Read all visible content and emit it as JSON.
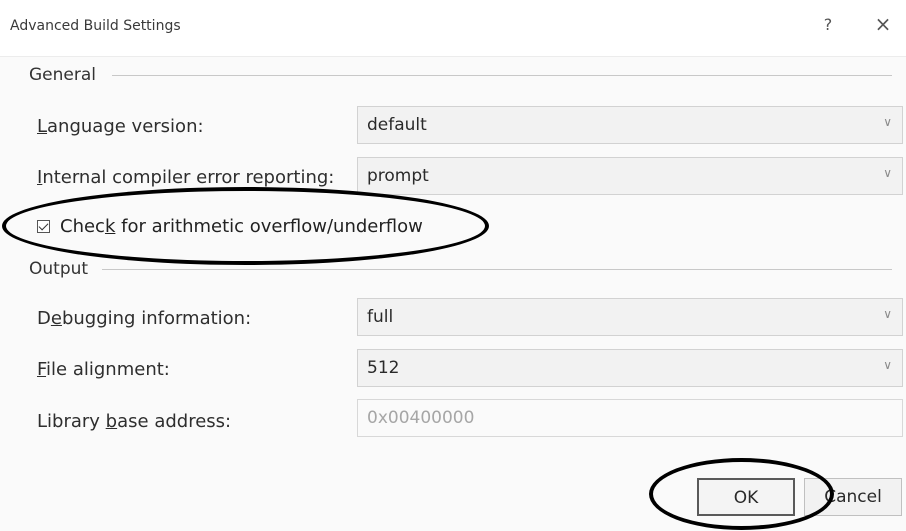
{
  "window": {
    "title": "Advanced Build Settings",
    "help_glyph": "?",
    "close_glyph": "×"
  },
  "general": {
    "group_label": "General",
    "language_version": {
      "label_pre": "",
      "label_accel": "L",
      "label_post": "anguage version:",
      "value": "default"
    },
    "ice_reporting": {
      "label_pre": "",
      "label_accel": "I",
      "label_post": "nternal compiler error reporting:",
      "value": "prompt"
    },
    "overflow_check": {
      "label_pre": "Chec",
      "label_accel": "k",
      "label_post": " for arithmetic overflow/underflow",
      "checked": true
    }
  },
  "output": {
    "group_label": "Output",
    "debugging": {
      "label_pre": "D",
      "label_accel": "e",
      "label_post": "bugging information:",
      "value": "full"
    },
    "file_alignment": {
      "label_pre": "",
      "label_accel": "F",
      "label_post": "ile alignment:",
      "value": "512"
    },
    "library_base": {
      "label_pre": "Library ",
      "label_accel": "b",
      "label_post": "ase address:",
      "value": "0x00400000"
    }
  },
  "buttons": {
    "ok": "OK",
    "cancel": "Cancel"
  },
  "icons": {
    "dropdown": "chevron-down-icon",
    "close": "close-icon",
    "help": "help-icon"
  }
}
